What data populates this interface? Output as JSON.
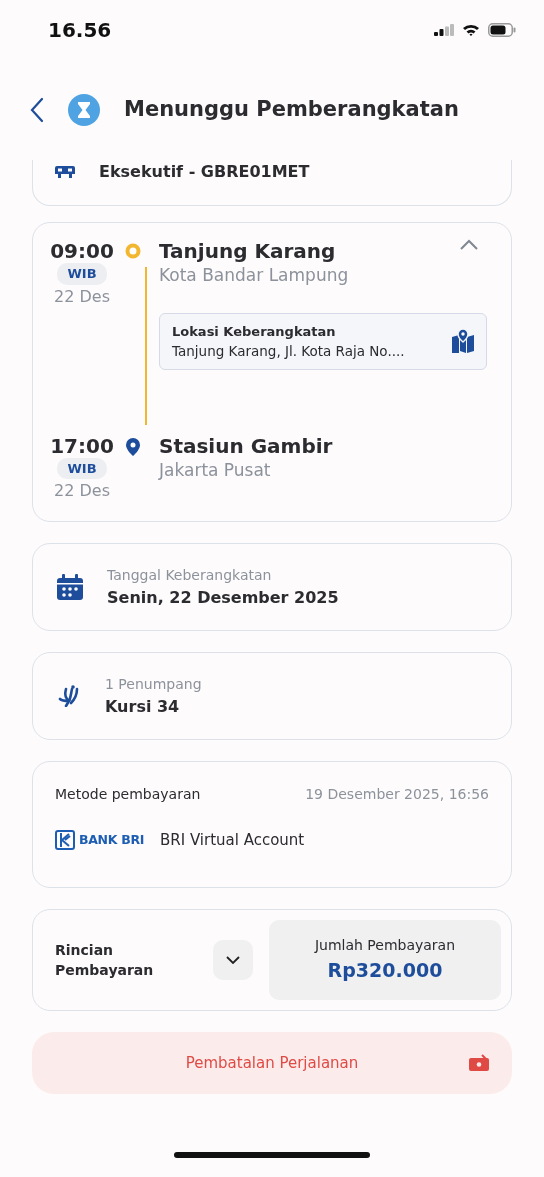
{
  "status_bar": {
    "time": "16.56"
  },
  "header": {
    "title": "Menunggu Pemberangkatan"
  },
  "train": {
    "class_code": "Eksekutif - GBRE01MET"
  },
  "route": {
    "expanded": true,
    "stops": [
      {
        "kind": "origin",
        "time": "09:00",
        "zone": "WIB",
        "date": "22 Des",
        "station": "Tanjung Karang",
        "city": "Kota Bandar Lampung"
      },
      {
        "kind": "destination",
        "time": "17:00",
        "zone": "WIB",
        "date": "22 Des",
        "station": "Stasiun Gambir",
        "city": "Jakarta Pusat"
      }
    ],
    "departure_location": {
      "label": "Lokasi Keberangkatan",
      "address": "Tanjung Karang, Jl. Kota Raja No...."
    }
  },
  "info_cards": [
    {
      "kind": "date",
      "label": "Tanggal Keberangkatan",
      "value": "Senin, 22 Desember 2025"
    },
    {
      "kind": "seat",
      "label": "1 Penumpang",
      "value": "Kursi 34"
    }
  ],
  "payment": {
    "label": "Metode pembayaran",
    "timestamp": "19 Desember 2025, 16:56",
    "bank_logo": "BANK BRI",
    "method": "BRI Virtual Account"
  },
  "summary": {
    "label": "Rincian Pembayaran",
    "expanded": false,
    "total_label": "Jumlah Pembayaran",
    "total": "Rp320.000"
  },
  "cancel_button": {
    "label": "Pembatalan Perjalanan"
  }
}
